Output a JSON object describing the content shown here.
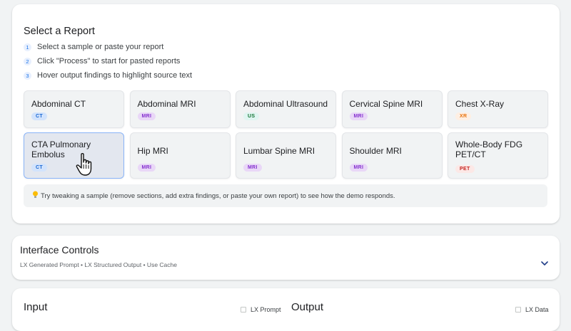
{
  "report_section": {
    "title": "Select a Report",
    "steps": [
      {
        "num": "1",
        "text": "Select a sample or paste your report"
      },
      {
        "num": "2",
        "text": "Click \"Process\" to start for pasted reports"
      },
      {
        "num": "3",
        "text": "Hover output findings to highlight source text"
      }
    ],
    "tiles": [
      {
        "name": "Abdominal CT",
        "badge": "CT"
      },
      {
        "name": "Abdominal MRI",
        "badge": "MRI"
      },
      {
        "name": "Abdominal Ultrasound",
        "badge": "US"
      },
      {
        "name": "Cervical Spine MRI",
        "badge": "MRI"
      },
      {
        "name": "Chest X-Ray",
        "badge": "XR"
      },
      {
        "name": "CTA Pulmonary Embolus",
        "badge": "CT"
      },
      {
        "name": "Hip MRI",
        "badge": "MRI"
      },
      {
        "name": "Lumbar Spine MRI",
        "badge": "MRI"
      },
      {
        "name": "Shoulder MRI",
        "badge": "MRI"
      },
      {
        "name": "Whole-Body FDG PET/CT",
        "badge": "PET"
      }
    ],
    "tip": "Try tweaking a sample (remove sections, add extra findings, or paste your own report) to see how the demo responds."
  },
  "badge_colors": {
    "CT": {
      "bg": "#d2e3fc",
      "fg": "#1967d2"
    },
    "MRI": {
      "bg": "#e9d7f7",
      "fg": "#8430ce"
    },
    "US": {
      "bg": "#e0f5f1",
      "fg": "#137333"
    },
    "XR": {
      "bg": "#feefe3",
      "fg": "#e8710a"
    },
    "PET": {
      "bg": "#fce8e6",
      "fg": "#c5221f"
    }
  },
  "controls": {
    "title": "Interface Controls",
    "summary": "LX Generated Prompt • LX Structured Output • Use Cache"
  },
  "io": {
    "input_label": "Input",
    "input_checkbox": "LX Prompt",
    "output_label": "Output",
    "output_checkbox": "LX Data"
  },
  "icons": {
    "tip": "lightbulb-icon",
    "cursor": "hand-pointer-icon",
    "chevron": "chevron-down-icon"
  }
}
